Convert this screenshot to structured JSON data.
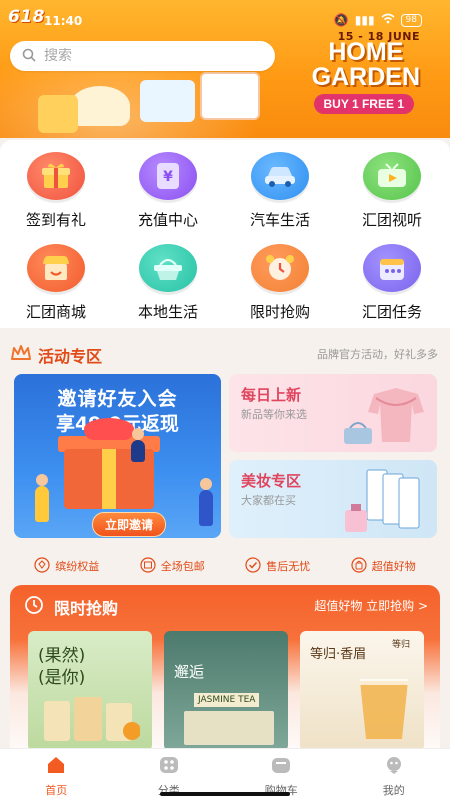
{
  "status": {
    "promo_tag": "618",
    "time": "11:40",
    "battery": "98"
  },
  "search": {
    "placeholder": "搜索"
  },
  "banner": {
    "dates": "15 - 18 JUNE",
    "title_line1": "HOME",
    "title_line2": "GARDEN",
    "offer": "BUY 1 FREE 1"
  },
  "grid": [
    {
      "label": "签到有礼",
      "icon": "gift-icon",
      "color": "#f0523e"
    },
    {
      "label": "充值中心",
      "icon": "coupon-icon",
      "color": "#8a4ff0"
    },
    {
      "label": "汽车生活",
      "icon": "car-icon",
      "color": "#2f8ff0"
    },
    {
      "label": "汇团视听",
      "icon": "tv-icon",
      "color": "#56c44a"
    },
    {
      "label": "汇团商城",
      "icon": "shop-icon",
      "color": "#f25c2d"
    },
    {
      "label": "本地生活",
      "icon": "basket-icon",
      "color": "#28c2a5"
    },
    {
      "label": "限时抢购",
      "icon": "alarm-clock-icon",
      "color": "#f38234"
    },
    {
      "label": "汇团任务",
      "icon": "calendar-icon",
      "color": "#7a63ec"
    }
  ],
  "activity": {
    "title": "活动专区",
    "subtitle": "品牌官方活动，好礼多多",
    "invite": {
      "title": "邀请好友入会",
      "subtitle": "享49.9元返现",
      "button": "立即邀请"
    },
    "new": {
      "title": "每日上新",
      "subtitle": "新品等你来选"
    },
    "beauty": {
      "title": "美妆专区",
      "subtitle": "大家都在买"
    }
  },
  "features": [
    {
      "label": "缤纷权益",
      "icon": "diamond-icon"
    },
    {
      "label": "全场包邮",
      "icon": "package-icon"
    },
    {
      "label": "售后无忧",
      "icon": "check-circle-icon"
    },
    {
      "label": "超值好物",
      "icon": "bag-icon"
    }
  ],
  "flash": {
    "title": "限时抢购",
    "more": "超值好物 立即抢购 >",
    "products": [
      {
        "text1": "(果然)",
        "text2": "(是你)"
      },
      {
        "text1": "邂逅",
        "text2": "JASMINE TEA"
      },
      {
        "text1": "等归·香眉",
        "text2": "等归"
      }
    ]
  },
  "tabbar": [
    {
      "label": "首页",
      "icon": "home-icon",
      "active": true
    },
    {
      "label": "分类",
      "icon": "category-icon",
      "active": false
    },
    {
      "label": "购物车",
      "icon": "cart-icon",
      "active": false
    },
    {
      "label": "我的",
      "icon": "profile-icon",
      "active": false
    }
  ],
  "colors": {
    "accent": "#f25b22",
    "banner": "#ff9a15",
    "flash": "#f5622b"
  }
}
